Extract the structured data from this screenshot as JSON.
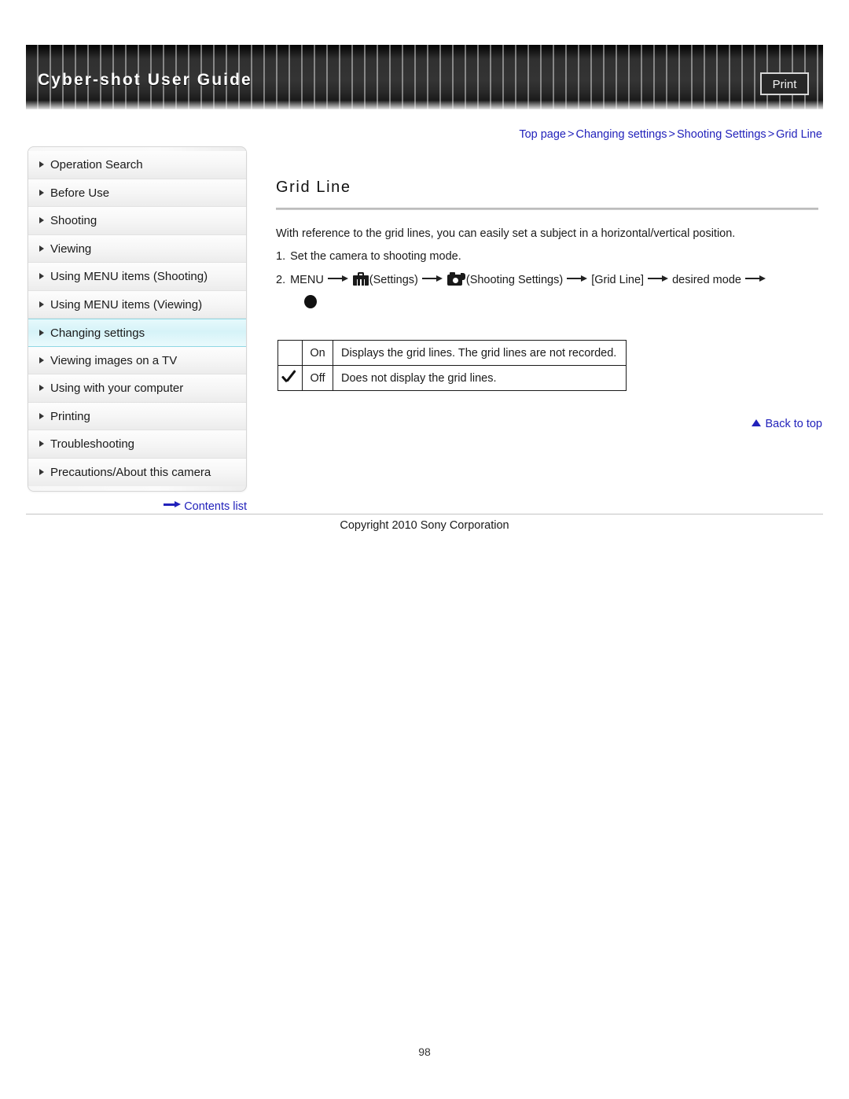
{
  "header": {
    "title": "Cyber-shot User Guide",
    "print_label": "Print"
  },
  "breadcrumb": {
    "items": [
      "Top page",
      "Changing settings",
      "Shooting Settings",
      "Grid Line"
    ],
    "separator": ">",
    "full_text": "Top page > Changing settings > Shooting Settings > Grid Line",
    "link_color": "#2222bb"
  },
  "sidebar": {
    "items": [
      {
        "label": "Operation Search",
        "active": false
      },
      {
        "label": "Before Use",
        "active": false
      },
      {
        "label": "Shooting",
        "active": false
      },
      {
        "label": "Viewing",
        "active": false
      },
      {
        "label": "Using MENU items (Shooting)",
        "active": false
      },
      {
        "label": "Using MENU items (Viewing)",
        "active": false
      },
      {
        "label": "Changing settings",
        "active": true
      },
      {
        "label": "Viewing images on a TV",
        "active": false
      },
      {
        "label": "Using with your computer",
        "active": false
      },
      {
        "label": "Printing",
        "active": false
      },
      {
        "label": "Troubleshooting",
        "active": false
      },
      {
        "label": "Precautions/About this camera",
        "active": false
      }
    ],
    "active_bg_color": "#d6f3f8",
    "contents_list_label": "Contents list"
  },
  "main": {
    "title": "Grid Line",
    "intro": "With reference to the grid lines, you can easily set a subject in a horizontal/vertical position.",
    "steps": [
      {
        "number": "1.",
        "text": "Set the camera to shooting mode."
      },
      {
        "number": "2.",
        "menu_label": "MENU",
        "settings_label": "(Settings)",
        "shooting_settings_label": "(Shooting Settings)",
        "grid_line_label": "[Grid Line]",
        "desired_mode_label": "desired mode"
      }
    ],
    "options_table": {
      "rows": [
        {
          "checked": false,
          "name": "On",
          "description": "Displays the grid lines. The grid lines are not recorded."
        },
        {
          "checked": true,
          "name": "Off",
          "description": "Does not display the grid lines."
        }
      ]
    },
    "back_to_top_label": "Back to top"
  },
  "footer": {
    "copyright": "Copyright 2010 Sony Corporation",
    "page_number": "98"
  }
}
